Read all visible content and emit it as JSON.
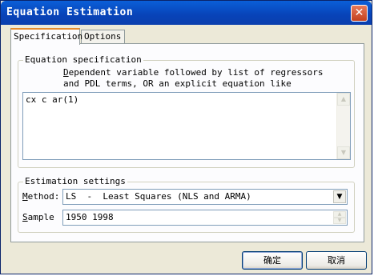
{
  "window": {
    "title": "Equation Estimation"
  },
  "tabs": [
    {
      "label": "Specification",
      "active": true
    },
    {
      "label": "Options",
      "active": false
    }
  ],
  "equation_spec": {
    "group_label": "Equation specification",
    "description_line1_pre": "",
    "description_line1_mnemonic": "D",
    "description_line1_post": "ependent variable followed by list of regressors",
    "description_line2": "and PDL terms, OR an explicit equation like",
    "equation_text": "cx c ar(1)"
  },
  "estimation_settings": {
    "group_label": "Estimation settings",
    "method_label_mnemonic": "M",
    "method_label_rest": "ethod:",
    "method_value": "LS  -  Least Squares (NLS and ARMA)",
    "sample_label_mnemonic": "S",
    "sample_label_rest": "ample",
    "sample_value": "1950 1998"
  },
  "buttons": {
    "ok": "确定",
    "cancel": "取消"
  },
  "icons": {
    "close": "close-icon",
    "dropdown": "chevron-down-icon",
    "scroll_up": "arrow-up-icon",
    "scroll_down": "arrow-down-icon"
  }
}
